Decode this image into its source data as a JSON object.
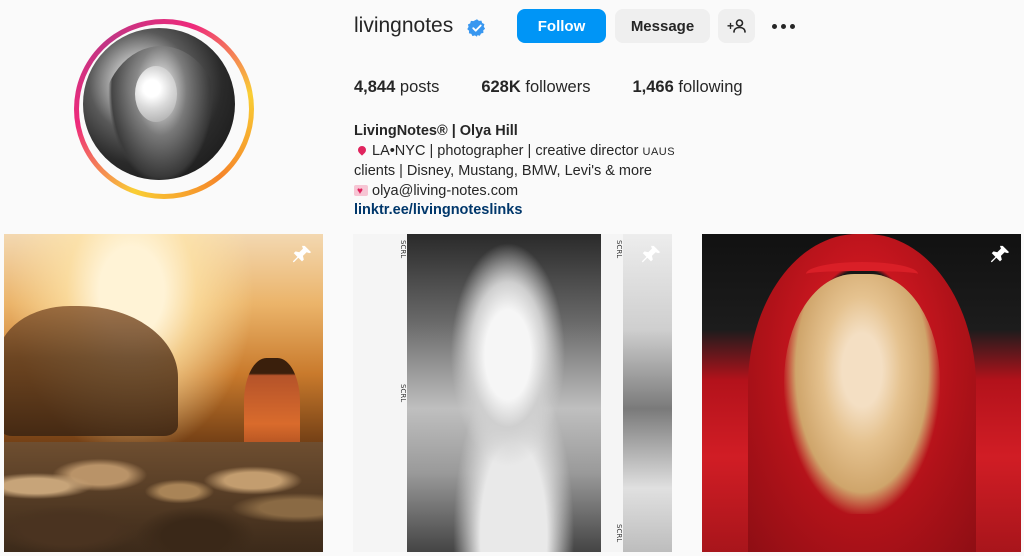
{
  "profile": {
    "username": "livingnotes",
    "verified": true,
    "follow_label": "Follow",
    "message_label": "Message",
    "add_user_icon": "add-user-icon",
    "more_icon": "more-options-icon"
  },
  "stats": {
    "posts_count": "4,844",
    "posts_label": "posts",
    "followers_count": "628K",
    "followers_label": "followers",
    "following_count": "1,466",
    "following_label": "following"
  },
  "bio": {
    "name": "LivingNotes® | Olya Hill",
    "line1": "LA•NYC | photographer | creative director ",
    "line1_suffix": "UAUS",
    "line2": "clients | Disney, Mustang, BMW, Levi's & more",
    "email": "olya@living-notes.com",
    "link": "linktr.ee/livingnoteslinks"
  },
  "posts": [
    {
      "pinned": true
    },
    {
      "pinned": true,
      "film_text": [
        "SCRL",
        "SCRL",
        "SCRL",
        "SCRL"
      ]
    },
    {
      "pinned": true
    }
  ],
  "colors": {
    "accent": "#0095f6",
    "link": "#00376b",
    "button_secondary": "#efefef"
  }
}
